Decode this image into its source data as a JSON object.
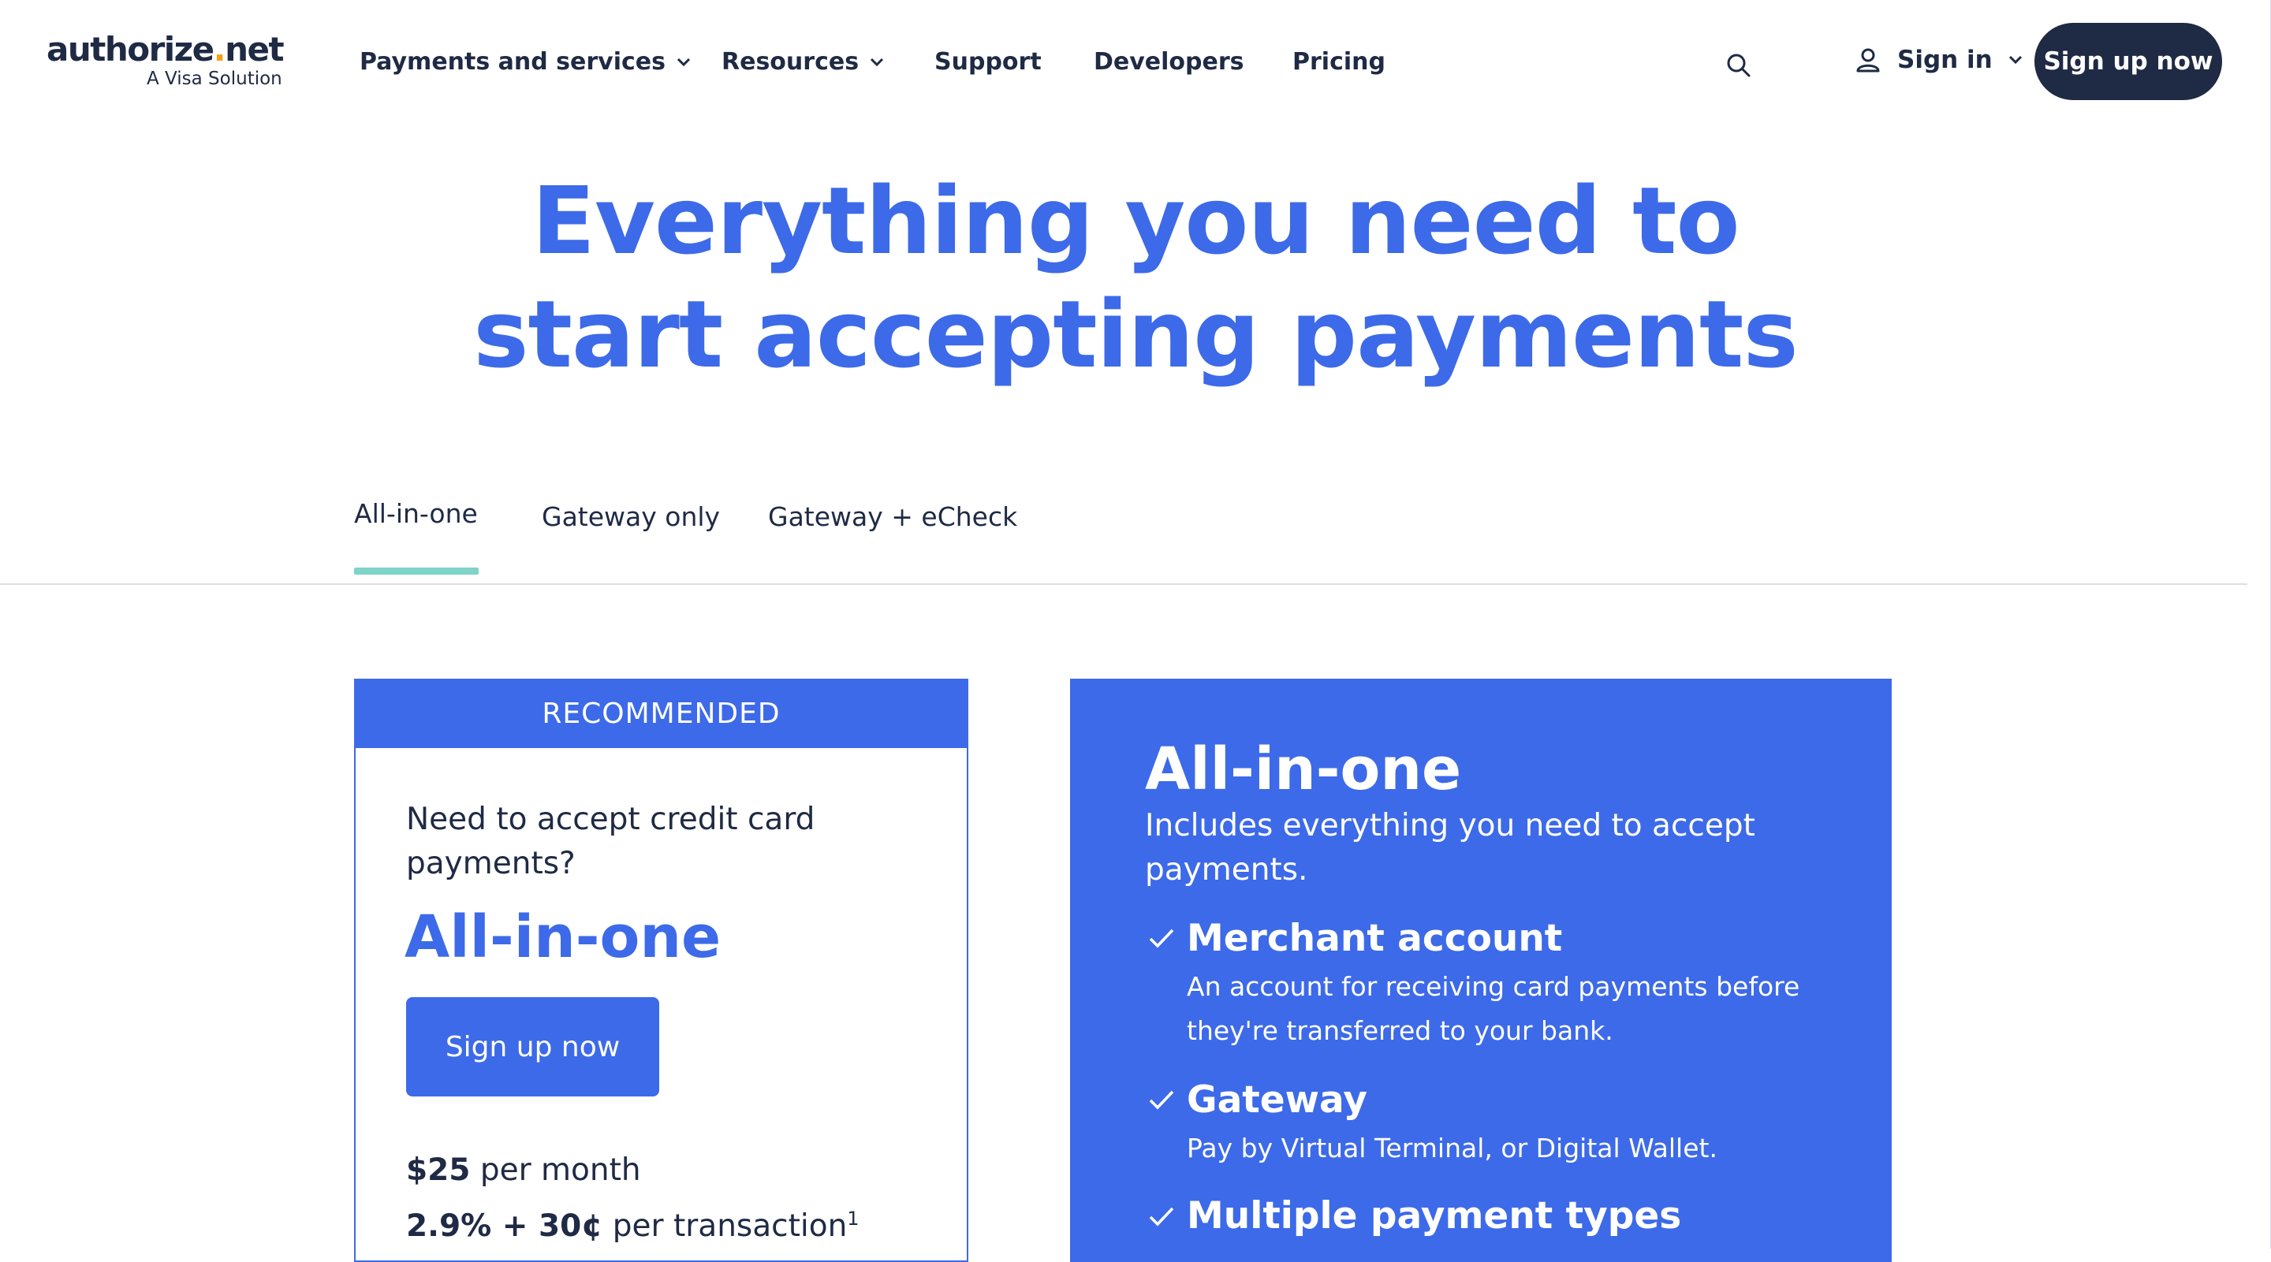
{
  "header": {
    "logo_main": "authorize",
    "logo_dot": ".",
    "logo_tld": "net",
    "logo_sub": "A Visa Solution",
    "nav": [
      {
        "label": "Payments and services"
      },
      {
        "label": "Resources"
      },
      {
        "label": "Support"
      },
      {
        "label": "Developers"
      },
      {
        "label": "Pricing"
      }
    ],
    "search_icon": "search-icon",
    "signin_label": "Sign in",
    "signup_label": "Sign up now"
  },
  "hero": {
    "line1": "Everything you need to",
    "line2": "start accepting payments"
  },
  "tabs": [
    {
      "label": "All-in-one",
      "active": true
    },
    {
      "label": "Gateway only"
    },
    {
      "label": "Gateway + eCheck"
    }
  ],
  "plan_card": {
    "badge": "RECOMMENDED",
    "question": "Need to accept credit card payments?",
    "title": "All-in-one",
    "button": "Sign up now",
    "price_amount": "$25",
    "price_unit": " per month",
    "fee_amount": "2.9% + 30¢",
    "fee_unit": " per transaction",
    "fee_footnote": "1"
  },
  "detail_card": {
    "title": "All-in-one",
    "subtitle": "Includes everything you need to accept payments.",
    "features": [
      {
        "title": "Merchant account",
        "desc": "An account for receiving card payments before they're transferred to your bank."
      },
      {
        "title": "Gateway",
        "desc": "Pay by Virtual Terminal, or Digital Wallet."
      },
      {
        "title": "Multiple payment types",
        "desc": ""
      }
    ]
  },
  "colors": {
    "brand_blue": "#3d6ae8",
    "navy": "#1f2a44",
    "tab_accent": "#7fd3c8",
    "logo_dot": "#f0a21a"
  }
}
